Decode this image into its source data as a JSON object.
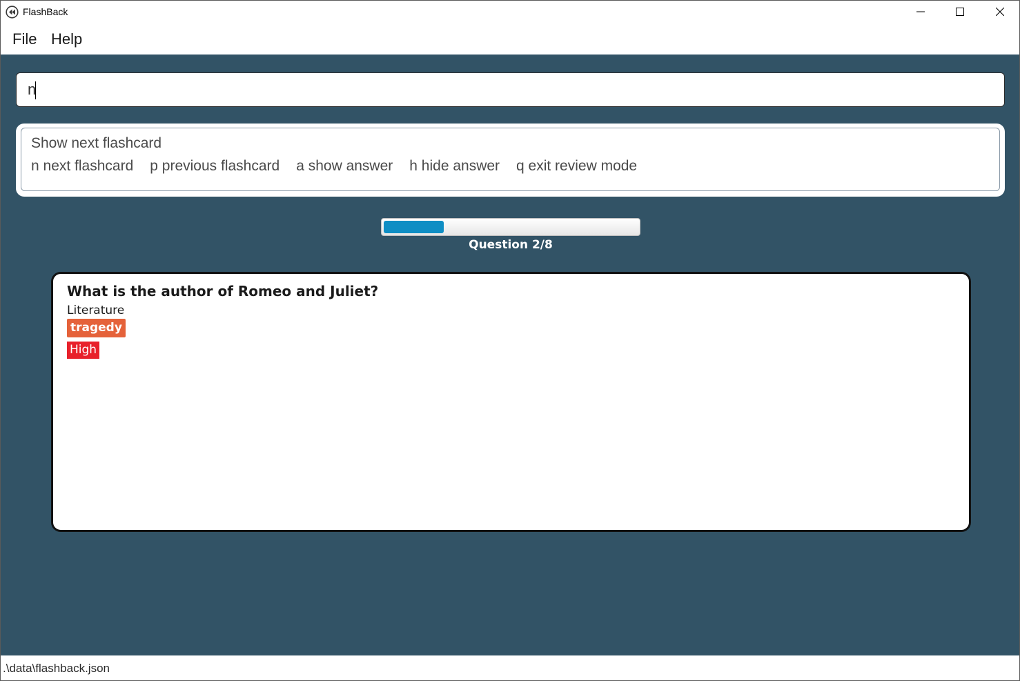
{
  "window": {
    "title": "FlashBack"
  },
  "menu": {
    "file": "File",
    "help": "Help"
  },
  "command": {
    "value": "n"
  },
  "result": {
    "title": "Show next flashcard",
    "commands": [
      "n next flashcard",
      "p previous flashcard",
      "a show answer",
      "h hide answer",
      "q exit review mode"
    ]
  },
  "progress": {
    "label": "Question 2/8",
    "current": 2,
    "total": 8,
    "fill_color": "#0f8ec4"
  },
  "card": {
    "question": "What is the author of Romeo and Juliet?",
    "category": "Literature",
    "tag": "tragedy",
    "priority": "High",
    "tag_color": "#e5623a",
    "priority_color": "#e8212b"
  },
  "status": {
    "file_path": ".\\data\\flashback.json"
  },
  "colors": {
    "background": "#325366"
  }
}
